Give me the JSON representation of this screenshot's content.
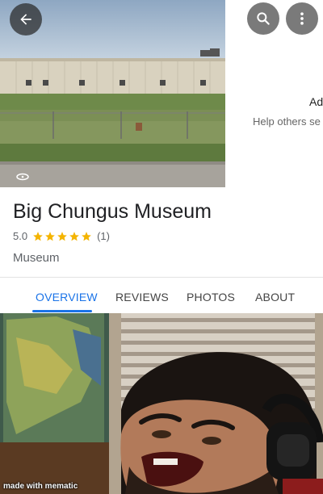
{
  "header": {
    "back_icon": "arrow-left-icon",
    "search_icon": "search-icon",
    "more_icon": "more-vert-icon"
  },
  "photo_strip": {
    "side_text_truncated": "Ad",
    "side_subtext_truncated": "Help others se"
  },
  "place": {
    "name": "Big Chungus Museum",
    "rating": "5.0",
    "stars": 5,
    "review_count": "(1)",
    "category": "Museum"
  },
  "tabs": [
    {
      "label": "OVERVIEW",
      "active": true
    },
    {
      "label": "REVIEWS",
      "active": false
    },
    {
      "label": "PHOTOS",
      "active": false
    },
    {
      "label": "ABOUT",
      "active": false
    }
  ],
  "meme": {
    "watermark": "made with mematic"
  },
  "colors": {
    "accent": "#1a73e8",
    "star": "#f4b400",
    "text_primary": "#202124",
    "text_secondary": "#5f6368"
  }
}
